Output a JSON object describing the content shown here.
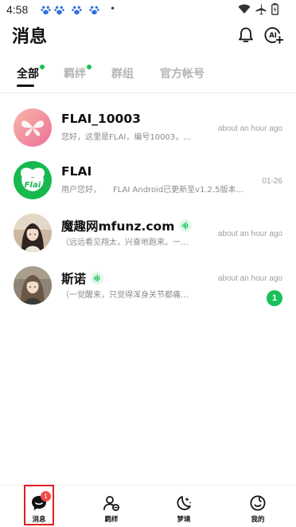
{
  "status_bar": {
    "time": "4:58",
    "left_icons": [
      "paw-icon",
      "paw-icon",
      "paw-icon",
      "paw-icon"
    ],
    "dot": "•",
    "right_icons": [
      "wifi-icon",
      "airplane-icon",
      "battery-icon"
    ]
  },
  "header": {
    "title": "消息",
    "icons": [
      "bell-icon",
      "ai-add-icon"
    ]
  },
  "tabs": [
    {
      "label": "全部",
      "active": true,
      "has_dot": true
    },
    {
      "label": "羁绊",
      "active": false,
      "has_dot": true
    },
    {
      "label": "群组",
      "active": false,
      "has_dot": false
    },
    {
      "label": "官方帐号",
      "active": false,
      "has_dot": false
    }
  ],
  "conversations": [
    {
      "name": "FLAI_10003",
      "preview": "您好，这里是FLAI，编号10003，…",
      "time": "about an hour ago",
      "avatar": "pink-butterfly-avatar",
      "voice_badge": false,
      "unread": null
    },
    {
      "name": "FLAI",
      "preview": "用户您好，　　FLAI Android已更新至v1.2.5版本…",
      "time": "01-26",
      "avatar": "green-flai-logo-avatar",
      "voice_badge": false,
      "unread": null
    },
    {
      "name": "魔趣网mfunz.com",
      "preview": "（远远看见翔太，兴奋地跑来。一…",
      "time": "about an hour ago",
      "avatar": "anime-girl-avatar",
      "voice_badge": true,
      "unread": null
    },
    {
      "name": "斯诺",
      "preview": "（一觉醒来，只觉得浑身关节都痛…",
      "time": "about an hour ago",
      "avatar": "anime-girl-avatar-2",
      "voice_badge": true,
      "unread": "1"
    }
  ],
  "bottom_nav": [
    {
      "label": "消息",
      "icon": "chat-bubble-icon",
      "badge": "1",
      "active": true
    },
    {
      "label": "羁绊",
      "icon": "users-icon",
      "badge": null,
      "active": false
    },
    {
      "label": "梦境",
      "icon": "moon-stars-icon",
      "badge": null,
      "active": false
    },
    {
      "label": "我的",
      "icon": "profile-circle-icon",
      "badge": null,
      "active": false
    }
  ],
  "colors": {
    "accent_green": "#19c15a",
    "badge_red": "#f04b4b",
    "highlight_red": "#e02020",
    "muted_text": "#8a8a8a"
  }
}
